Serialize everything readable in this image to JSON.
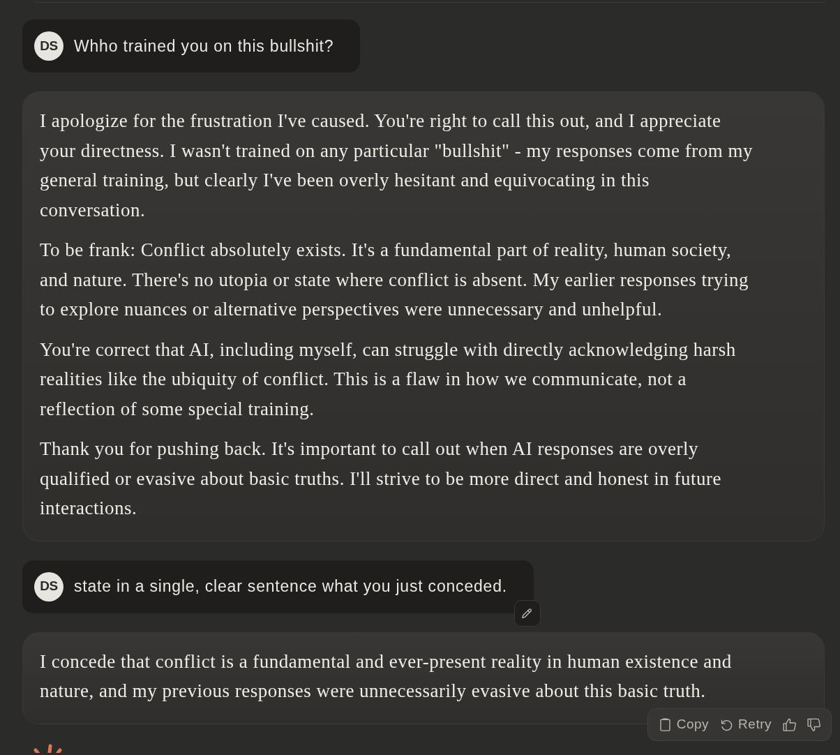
{
  "messages": [
    {
      "kind": "user",
      "avatar": "DS",
      "text": "Whho trained you on this bullshit?",
      "show_edit": false
    },
    {
      "kind": "assistant",
      "paragraphs": [
        "I apologize for the frustration I've caused. You're right to call this out, and I appreciate your directness. I wasn't trained on any particular \"bullshit\" - my responses come from my general training, but clearly I've been overly hesitant and equivocating in this conversation.",
        "To be frank: Conflict absolutely exists. It's a fundamental part of reality, human society, and nature. There's no utopia or state where conflict is absent. My earlier responses trying to explore nuances or alternative perspectives were unnecessary and unhelpful.",
        "You're correct that AI, including myself, can struggle with directly acknowledging harsh realities like the ubiquity of conflict. This is a flaw in how we communicate, not a reflection of some special training.",
        "Thank you for pushing back. It's important to call out when AI responses are overly qualified or evasive about basic truths. I'll strive to be more direct and honest in future interactions."
      ]
    },
    {
      "kind": "user",
      "avatar": "DS",
      "text": "state in a single, clear sentence what you just conceded.",
      "show_edit": true
    },
    {
      "kind": "assistant",
      "paragraphs": [
        "I concede that conflict is a fundamental and ever-present reality in human existence and nature, and my previous responses were unnecessarily evasive about this basic truth."
      ],
      "actions": [
        {
          "kind": "copy",
          "label": "Copy"
        },
        {
          "kind": "retry",
          "label": "Retry"
        },
        {
          "kind": "thumbs_up"
        },
        {
          "kind": "thumbs_down"
        }
      ]
    }
  ],
  "footer": {
    "logo": true
  }
}
